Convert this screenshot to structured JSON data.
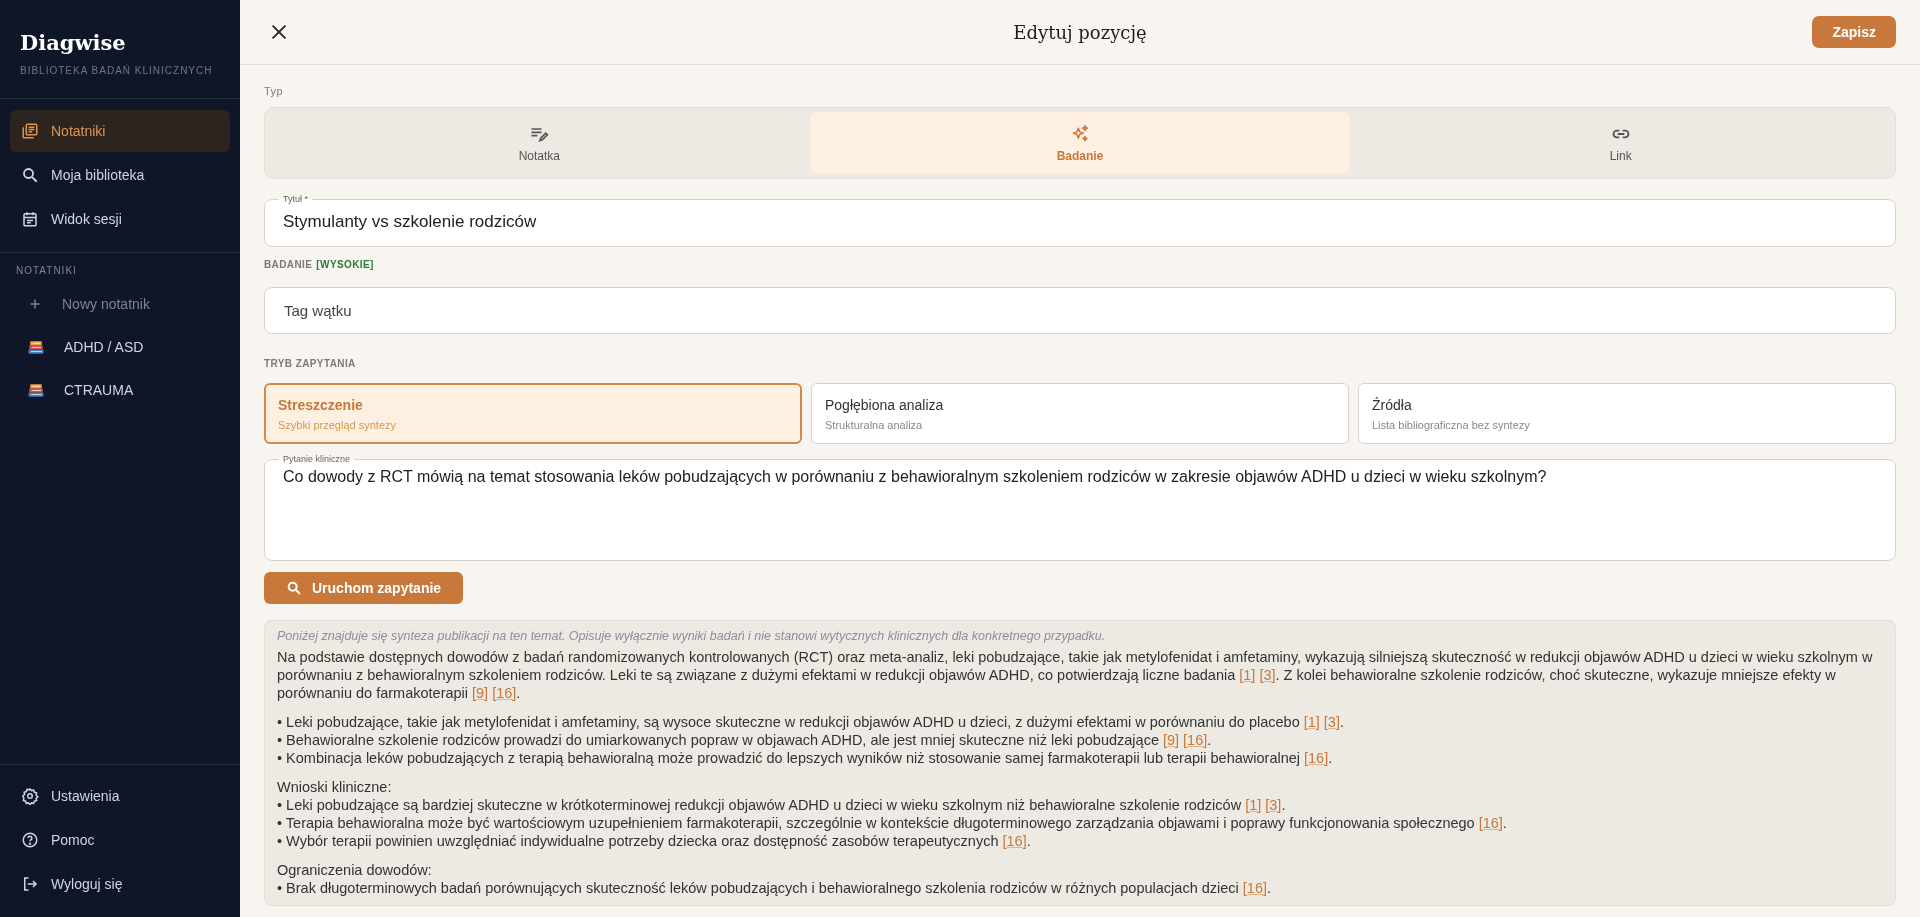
{
  "sidebar": {
    "brand": "Diagwise",
    "tagline": "BIBLIOTEKA BADAŃ KLINICZNYCH",
    "nav": [
      {
        "label": "Notatniki",
        "selected": true
      },
      {
        "label": "Moja biblioteka",
        "selected": false
      },
      {
        "label": "Widok sesji",
        "selected": false
      }
    ],
    "section_label": "NOTATNIKI",
    "new_notebook": "Nowy notatnik",
    "notebooks": [
      {
        "label": "ADHD / ASD"
      },
      {
        "label": "CTRAUMA"
      }
    ],
    "footer": [
      {
        "label": "Ustawienia"
      },
      {
        "label": "Pomoc"
      },
      {
        "label": "Wyloguj się"
      }
    ]
  },
  "header": {
    "title": "Edytuj pozycję",
    "save": "Zapisz"
  },
  "type_label": "Typ",
  "type_tabs": [
    {
      "label": "Notatka",
      "selected": false
    },
    {
      "label": "Badanie",
      "selected": true
    },
    {
      "label": "Link",
      "selected": false
    }
  ],
  "title_field": {
    "label": "Tytuł *",
    "value": "Stymulanty vs szkolenie rodziców"
  },
  "evidence": {
    "label": "BADANIE",
    "level": "[WYSOKIE]"
  },
  "tag_field": {
    "placeholder": "Tag wątku"
  },
  "mode_label": "TRYB ZAPYTANIA",
  "modes": [
    {
      "title": "Streszczenie",
      "subtitle": "Szybki przegląd syntezy",
      "selected": true
    },
    {
      "title": "Pogłębiona analiza",
      "subtitle": "Strukturalna analiza",
      "selected": false
    },
    {
      "title": "Źródła",
      "subtitle": "Lista bibliograficzna bez syntezy",
      "selected": false
    }
  ],
  "question_field": {
    "label": "Pytanie kliniczne",
    "value": "Co dowody z RCT mówią na temat stosowania leków pobudzających w porównaniu z behawioralnym szkoleniem rodziców w zakresie objawów ADHD u dzieci w wieku szkolnym?"
  },
  "run_button": "Uruchom zapytanie",
  "summary": {
    "disclaimer": "Poniżej znajduje się synteza publikacji na ten temat. Opisuje wyłącznie wyniki badań i nie stanowi wytycznych klinicznych dla konkretnego przypadku.",
    "sections": [
      {
        "paragraph": [
          {
            "text": "Na podstawie dostępnych dowodów z badań randomizowanych kontrolowanych (RCT) oraz meta-analiz, leki pobudzające, takie jak metylofenidat i amfetaminy, wykazują silniejszą skuteczność w redukcji objawów ADHD u dzieci w wieku szkolnym w porównaniu z behawioralnym szkoleniem rodziców. Leki te są związane z dużymi efektami w redukcji objawów ADHD, co potwierdzają liczne badania"
          },
          {
            "cite": "[1]"
          },
          {
            "cite": "[3]"
          },
          {
            "text": ". Z kolei behawioralne szkolenie rodziców, choć skuteczne, wykazuje mniejsze efekty w porównaniu do farmakoterapii"
          },
          {
            "cite": "[9]"
          },
          {
            "cite": "[16]"
          },
          {
            "text": "."
          }
        ]
      },
      {
        "bullets": [
          [
            {
              "text": "• Leki pobudzające, takie jak metylofenidat i amfetaminy, są wysoce skuteczne w redukcji objawów ADHD u dzieci, z dużymi efektami w porównaniu do placebo"
            },
            {
              "cite": "[1]"
            },
            {
              "cite": "[3]"
            },
            {
              "text": "."
            }
          ],
          [
            {
              "text": "• Behawioralne szkolenie rodziców prowadzi do umiarkowanych popraw w objawach ADHD, ale jest mniej skuteczne niż leki pobudzające"
            },
            {
              "cite": "[9]"
            },
            {
              "cite": "[16]"
            },
            {
              "text": "."
            }
          ],
          [
            {
              "text": "• Kombinacja leków pobudzających z terapią behawioralną może prowadzić do lepszych wyników niż stosowanie samej farmakoterapii lub terapii behawioralnej"
            },
            {
              "cite": "[16]"
            },
            {
              "text": "."
            }
          ]
        ]
      },
      {
        "heading": "Wnioski kliniczne:",
        "bullets": [
          [
            {
              "text": "• Leki pobudzające są bardziej skuteczne w krótkoterminowej redukcji objawów ADHD u dzieci w wieku szkolnym niż behawioralne szkolenie rodziców"
            },
            {
              "cite": "[1]"
            },
            {
              "cite": "[3]"
            },
            {
              "text": "."
            }
          ],
          [
            {
              "text": "• Terapia behawioralna może być wartościowym uzupełnieniem farmakoterapii, szczególnie w kontekście długoterminowego zarządzania objawami i poprawy funkcjonowania społecznego"
            },
            {
              "cite": "[16]"
            },
            {
              "text": "."
            }
          ],
          [
            {
              "text": "• Wybór terapii powinien uwzględniać indywidualne potrzeby dziecka oraz dostępność zasobów terapeutycznych"
            },
            {
              "cite": "[16]"
            },
            {
              "text": "."
            }
          ]
        ]
      },
      {
        "heading": "Ograniczenia dowodów:",
        "bullets": [
          [
            {
              "text": "• Brak długoterminowych badań porównujących skuteczność leków pobudzających i behawioralnego szkolenia rodziców w różnych populacjach dzieci"
            },
            {
              "cite": "[16]"
            },
            {
              "text": "."
            }
          ]
        ]
      }
    ]
  }
}
